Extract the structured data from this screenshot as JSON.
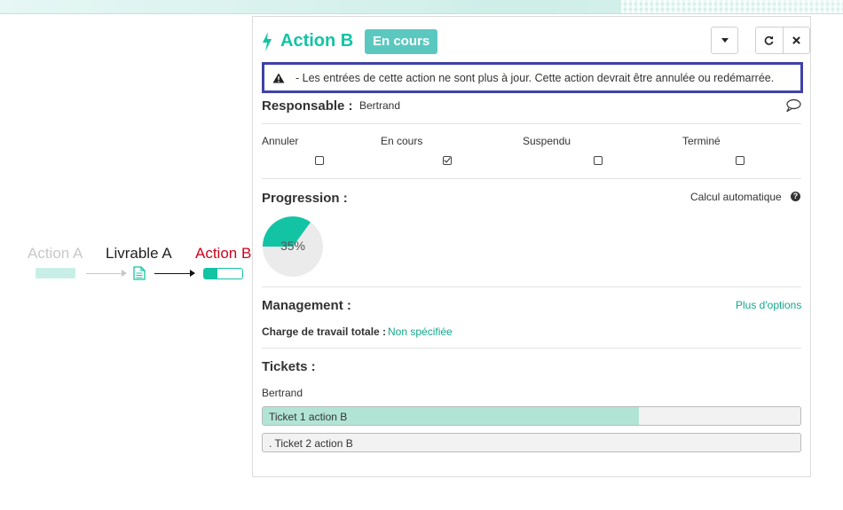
{
  "workflow": {
    "nodes": [
      {
        "label": "Action A"
      },
      {
        "label": "Livrable A"
      },
      {
        "label": "Action B",
        "progress": 0.35
      }
    ]
  },
  "panel": {
    "title": "Action B",
    "status_badge": "En cours",
    "warning": "- Les entrées de cette action ne sont plus à jour. Cette action devrait être annulée ou redémarrée.",
    "responsable": {
      "label": "Responsable :",
      "value": "Bertrand"
    },
    "statuses": [
      {
        "label": "Annuler",
        "checked": false
      },
      {
        "label": "En cours",
        "checked": true
      },
      {
        "label": "Suspendu",
        "checked": false
      },
      {
        "label": "Terminé",
        "checked": false
      }
    ],
    "progression": {
      "label": "Progression :",
      "auto_calc_label": "Calcul automatique",
      "percent": 35,
      "percent_label": "35%"
    },
    "management": {
      "label": "Management :",
      "more_options": "Plus d'options",
      "charge_label": "Charge de travail totale :",
      "charge_value": "Non spécifiée"
    },
    "tickets": {
      "label": "Tickets :",
      "owner": "Bertrand",
      "items": [
        {
          "label": "Ticket 1 action B",
          "progress": 0.7
        },
        {
          "label": ". Ticket 2 action B",
          "progress": 0
        }
      ]
    }
  },
  "colors": {
    "accent": "#12c4a4",
    "badge": "#5bc8c0",
    "warning_border": "#3f41a8",
    "link": "#12a88c",
    "error_label": "#d0021b"
  },
  "icons": [
    "bolt-icon",
    "caret-down-icon",
    "refresh-icon",
    "close-icon",
    "warning-icon",
    "comment-icon",
    "help-icon",
    "document-icon"
  ]
}
